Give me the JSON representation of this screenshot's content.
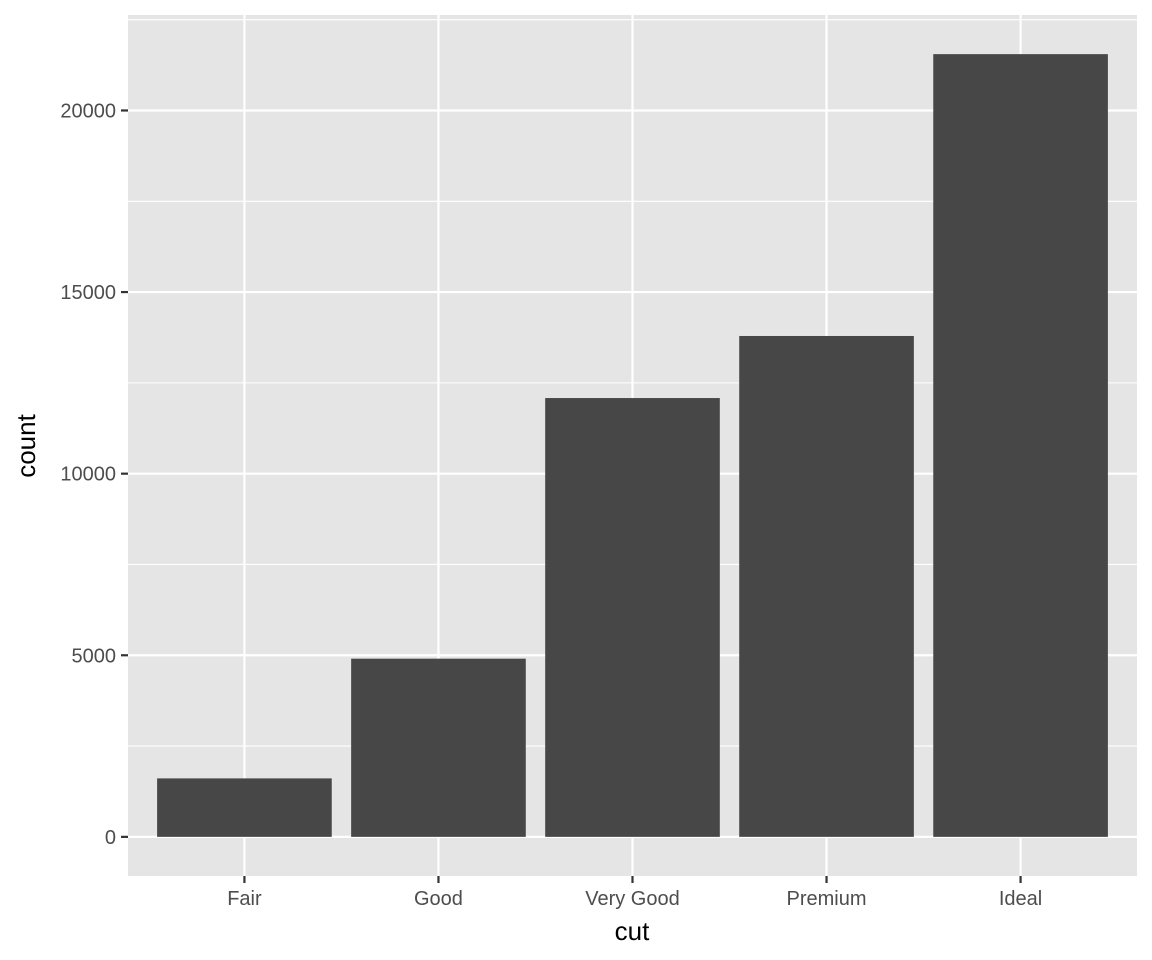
{
  "chart_data": {
    "type": "bar",
    "title": "",
    "xlabel": "cut",
    "ylabel": "count",
    "categories": [
      "Fair",
      "Good",
      "Very Good",
      "Premium",
      "Ideal"
    ],
    "values": [
      1610,
      4906,
      12082,
      13791,
      21551
    ],
    "ylim": [
      -1077.55,
      22628.55
    ],
    "yticks": [
      0,
      5000,
      10000,
      15000,
      20000
    ],
    "ytick_labels": [
      "0",
      "5000",
      "10000",
      "15000",
      "20000"
    ],
    "grid": true,
    "legend": "none",
    "colors": {
      "panel": "#e5e5e5",
      "grid": "#ffffff",
      "bar": "#474747",
      "tick": "#333333"
    }
  }
}
